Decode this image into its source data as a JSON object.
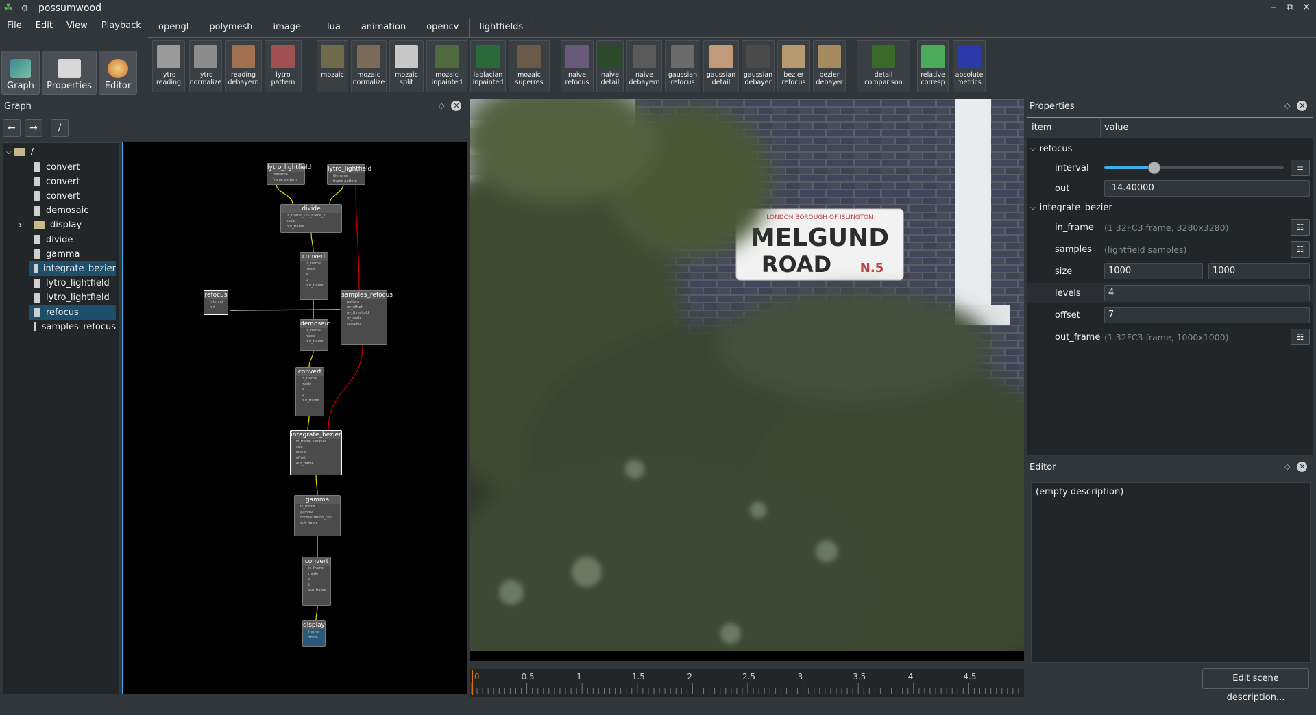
{
  "window": {
    "title": "possumwood",
    "minimize": "–",
    "maximize": "⧉",
    "close": "✕"
  },
  "menu": [
    "File",
    "Edit",
    "View",
    "Playback"
  ],
  "tabs": [
    "opengl",
    "polymesh",
    "image",
    "lua",
    "animation",
    "opencv",
    "lightfields"
  ],
  "active_tab": "lightfields",
  "toolbar": [
    {
      "label": "lytro\nreading",
      "color": "#9a9a9a"
    },
    {
      "label": "lytro\nnormalize",
      "color": "#8c8c8c"
    },
    {
      "label": "reading\ndebayern",
      "color": "#a07050"
    },
    {
      "label": "lytro\npattern",
      "color": "#a05050"
    },
    {
      "label": "mozaic",
      "color": "#6e6a4a"
    },
    {
      "label": "mozaic\nnormalize",
      "color": "#7a6a5a"
    },
    {
      "label": "mozaic\nsplit",
      "color": "#c8c8c8"
    },
    {
      "label": "mozaic\ninpainted",
      "color": "#4e6a3e"
    },
    {
      "label": "laplacian\ninpainted",
      "color": "#2a6a3a"
    },
    {
      "label": "mozaic\nsuperres",
      "color": "#6a5a4a"
    },
    {
      "label": "naive\nrefocus",
      "color": "#6a5a7a"
    },
    {
      "label": "naive\ndetail",
      "color": "#2a4a2a"
    },
    {
      "label": "naive\ndebayern",
      "color": "#5a5a5a"
    },
    {
      "label": "gaussian\nrefocus",
      "color": "#6a6a6a"
    },
    {
      "label": "gaussian\ndetail",
      "color": "#c09a7a"
    },
    {
      "label": "gaussian\ndebayer",
      "color": "#4a4a4a"
    },
    {
      "label": "bezier\nrefocus",
      "color": "#b89a70"
    },
    {
      "label": "bezier\ndebayer",
      "color": "#a88a60"
    },
    {
      "label": "detail\ncomparison",
      "color": "#3a6a2a"
    },
    {
      "label": "relative\ncorresp",
      "color": "#4aaa5a"
    },
    {
      "label": "absolute\nmetrics",
      "color": "#2a3aaa"
    }
  ],
  "side_buttons": [
    {
      "label": "Graph"
    },
    {
      "label": "Properties"
    },
    {
      "label": "Editor"
    }
  ],
  "graph_panel": {
    "title": "Graph",
    "path": "/",
    "back": "←",
    "forward": "→"
  },
  "tree": {
    "root": "/",
    "items": [
      "convert",
      "convert",
      "convert",
      "demosaic",
      "display",
      "divide",
      "gamma",
      "integrate_bezier",
      "lytro_lightfield",
      "lytro_lightfield",
      "refocus",
      "samples_refocus"
    ],
    "selected": [
      7,
      10
    ]
  },
  "nodes": [
    {
      "title": "lytro_lightfield",
      "ports": [
        "filename",
        "frame   pattern"
      ]
    },
    {
      "title": "lytro_lightfield",
      "ports": [
        "filename",
        "frame   pattern"
      ]
    },
    {
      "title": "divide",
      "ports": [
        "in_frame_1   in_frame_2",
        "scale",
        "out_frame"
      ]
    },
    {
      "title": "convert",
      "ports": [
        "in_frame",
        "mode",
        "a",
        "b",
        "out_frame"
      ]
    },
    {
      "title": "refocus",
      "ports": [
        "interval",
        "out"
      ]
    },
    {
      "title": "samples_refocus",
      "ports": [
        "pattern",
        "uv_offset",
        "uv_threshold",
        "xy_scale",
        "samples"
      ]
    },
    {
      "title": "demosaic",
      "ports": [
        "in_frame",
        "mode",
        "out_frame"
      ]
    },
    {
      "title": "convert",
      "ports": [
        "in_frame",
        "mode",
        "a",
        "b",
        "out_frame"
      ]
    },
    {
      "title": "integrate_bezier",
      "ports": [
        "in_frame   samples",
        "size",
        "levels",
        "offset",
        "out_frame"
      ]
    },
    {
      "title": "gamma",
      "ports": [
        "in_frame",
        "gamma",
        "normalization_coef",
        "out_frame"
      ]
    },
    {
      "title": "convert",
      "ports": [
        "in_frame",
        "mode",
        "a",
        "b",
        "out_frame"
      ]
    },
    {
      "title": "display",
      "ports": [
        "frame",
        "zoom"
      ]
    }
  ],
  "viewer": {
    "sign_top": "LONDON BOROUGH OF ISLINGTON",
    "sign_line1": "MELGUND",
    "sign_line2": "ROAD",
    "sign_code": "N.5"
  },
  "timeline": {
    "ticks": [
      "0",
      "0.5",
      "1",
      "1.5",
      "2",
      "2.5",
      "3",
      "3.5",
      "4",
      "4.5"
    ]
  },
  "properties": {
    "title": "Properties",
    "col_item": "item",
    "col_value": "value",
    "refocus": "refocus",
    "interval": "interval",
    "interval_level": 0.28,
    "out": "out",
    "out_value": "-14.40000",
    "integrate": "integrate_bezier",
    "in_frame": "in_frame",
    "in_frame_value": "(1 32FC3 frame, 3280x3280)",
    "samples": "samples",
    "samples_value": "(lightfield samples)",
    "size": "size",
    "size_w": "1000",
    "size_h": "1000",
    "levels": "levels",
    "levels_value": "4",
    "offset": "offset",
    "offset_value": "7",
    "out_frame": "out_frame",
    "out_frame_value": "(1 32FC3 frame, 1000x1000)"
  },
  "editor": {
    "title": "Editor",
    "text": "(empty description)",
    "button": "Edit scene description..."
  },
  "colors": {
    "accent": "#3daee9",
    "selection": "#1d4e6b",
    "port_yellow": "#e8e000",
    "link_red": "#cc0000"
  }
}
